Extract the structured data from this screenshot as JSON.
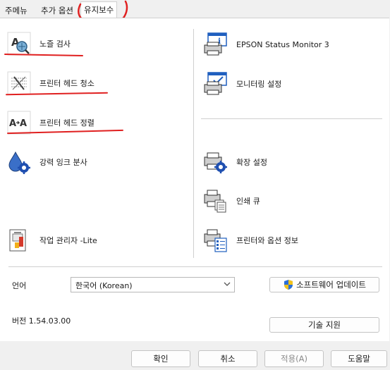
{
  "tabs": [
    {
      "label": "주메뉴"
    },
    {
      "label": "추가 옵션"
    },
    {
      "label": "유지보수"
    }
  ],
  "tools_left": [
    {
      "label": "노즐 검사"
    },
    {
      "label": "프린터 헤드 청소"
    },
    {
      "label": "프린터 헤드 정렬"
    },
    {
      "label": "강력 잉크 분사"
    },
    {
      "label": "작업 관리자 -Lite"
    }
  ],
  "tools_right": [
    {
      "label": "EPSON Status Monitor 3"
    },
    {
      "label": "모니터링 설정"
    },
    {
      "label": "확장 설정"
    },
    {
      "label": "인쇄 큐"
    },
    {
      "label": "프린터와 옵션 정보"
    }
  ],
  "language": {
    "label": "언어",
    "value": "한국어 (Korean)"
  },
  "update_button": "소프트웨어 업데이트",
  "version": "버전 1.54.03.00",
  "support_button": "기술 지원",
  "footer": {
    "ok": "확인",
    "cancel": "취소",
    "apply": "적용(A)",
    "help": "도움말"
  },
  "colors": {
    "annotation_red": "#e02020",
    "icon_blue": "#1f5fbf",
    "shield_blue": "#2b6fd6",
    "shield_yellow": "#f2c21b"
  }
}
